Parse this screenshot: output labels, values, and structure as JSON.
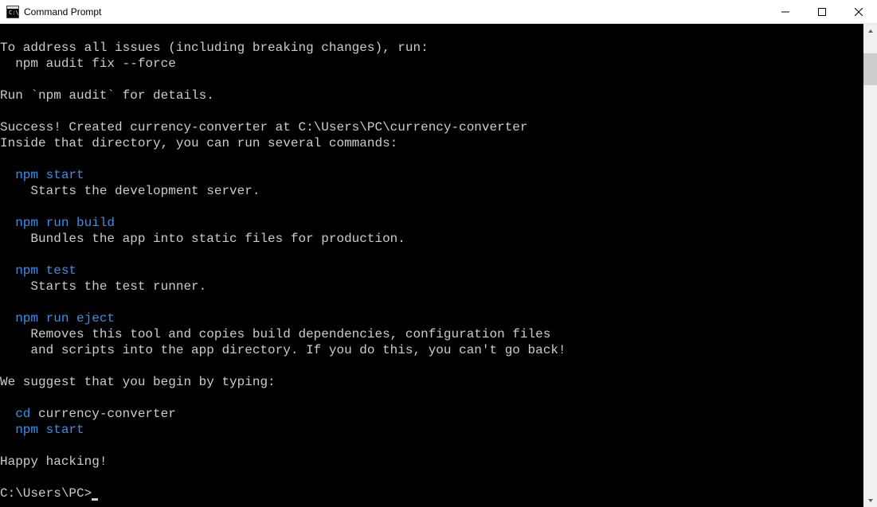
{
  "window": {
    "title": "Command Prompt"
  },
  "terminal": {
    "lines": [
      {
        "type": "blank",
        "text": ""
      },
      {
        "type": "plain",
        "text": "To address all issues (including breaking changes), run:"
      },
      {
        "type": "plain",
        "text": "  npm audit fix --force"
      },
      {
        "type": "blank",
        "text": ""
      },
      {
        "type": "plain",
        "text": "Run `npm audit` for details."
      },
      {
        "type": "blank",
        "text": ""
      },
      {
        "type": "plain",
        "text": "Success! Created currency-converter at C:\\Users\\PC\\currency-converter"
      },
      {
        "type": "plain",
        "text": "Inside that directory, you can run several commands:"
      },
      {
        "type": "blank",
        "text": ""
      },
      {
        "type": "cmd",
        "prefix": "  ",
        "cmd": "npm start",
        "rest": ""
      },
      {
        "type": "plain",
        "text": "    Starts the development server."
      },
      {
        "type": "blank",
        "text": ""
      },
      {
        "type": "cmd",
        "prefix": "  ",
        "cmd": "npm run build",
        "rest": ""
      },
      {
        "type": "plain",
        "text": "    Bundles the app into static files for production."
      },
      {
        "type": "blank",
        "text": ""
      },
      {
        "type": "cmd",
        "prefix": "  ",
        "cmd": "npm test",
        "rest": ""
      },
      {
        "type": "plain",
        "text": "    Starts the test runner."
      },
      {
        "type": "blank",
        "text": ""
      },
      {
        "type": "cmd",
        "prefix": "  ",
        "cmd": "npm run eject",
        "rest": ""
      },
      {
        "type": "plain",
        "text": "    Removes this tool and copies build dependencies, configuration files"
      },
      {
        "type": "plain",
        "text": "    and scripts into the app directory. If you do this, you can't go back!"
      },
      {
        "type": "blank",
        "text": ""
      },
      {
        "type": "plain",
        "text": "We suggest that you begin by typing:"
      },
      {
        "type": "blank",
        "text": ""
      },
      {
        "type": "cmd",
        "prefix": "  ",
        "cmd": "cd",
        "rest": " currency-converter"
      },
      {
        "type": "cmd",
        "prefix": "  ",
        "cmd": "npm start",
        "rest": ""
      },
      {
        "type": "blank",
        "text": ""
      },
      {
        "type": "plain",
        "text": "Happy hacking!"
      },
      {
        "type": "blank",
        "text": ""
      },
      {
        "type": "prompt",
        "text": "C:\\Users\\PC>"
      }
    ]
  }
}
